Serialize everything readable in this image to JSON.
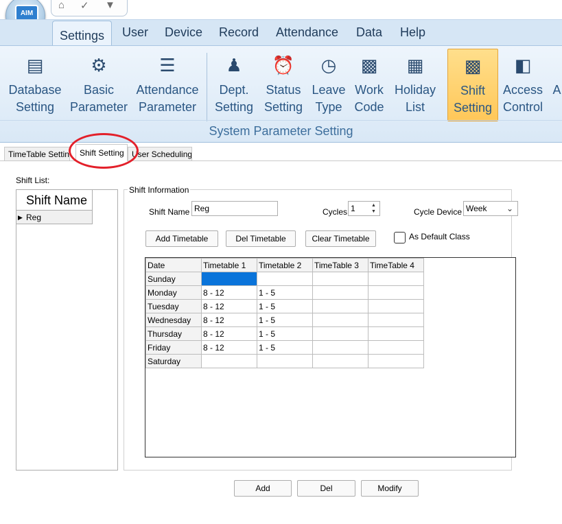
{
  "app": {
    "logo_text": "AIM"
  },
  "menu": {
    "tabs": [
      {
        "label": "Settings"
      },
      {
        "label": "User"
      },
      {
        "label": "Device"
      },
      {
        "label": "Record"
      },
      {
        "label": "Attendance"
      },
      {
        "label": "Data"
      },
      {
        "label": "Help"
      }
    ],
    "active": "Settings"
  },
  "ribbon": {
    "group_title": "System Parameter Setting",
    "buttons": [
      {
        "line1": "Database",
        "line2": "Setting",
        "icon": "database-icon"
      },
      {
        "line1": "Basic",
        "line2": "Parameter",
        "icon": "gears-icon"
      },
      {
        "line1": "Attendance",
        "line2": "Parameter",
        "icon": "scroll-icon"
      },
      {
        "line1": "Dept.",
        "line2": "Setting",
        "icon": "org-chart-icon"
      },
      {
        "line1": "Status",
        "line2": "Setting",
        "icon": "alarm-clock-icon"
      },
      {
        "line1": "Leave",
        "line2": "Type",
        "icon": "clock-person-icon"
      },
      {
        "line1": "Work",
        "line2": "Code",
        "icon": "id-gear-icon"
      },
      {
        "line1": "Holiday",
        "line2": "List",
        "icon": "calendar-icon"
      },
      {
        "line1": "Shift",
        "line2": "Setting",
        "icon": "shift-board-icon"
      },
      {
        "line1": "Access",
        "line2": "Control",
        "icon": "door-icon"
      },
      {
        "line1": "A",
        "line2": "",
        "icon": "more-icon"
      }
    ],
    "active": "Shift Setting"
  },
  "page_tabs": [
    {
      "label": "TimeTable Setting"
    },
    {
      "label": "Shift Setting"
    },
    {
      "label": "User Scheduling"
    }
  ],
  "shift_list": {
    "label": "Shift List:",
    "header": "Shift Name",
    "rows": [
      "Reg"
    ]
  },
  "shift_info": {
    "legend": "Shift Information",
    "shift_name_label": "Shift Name",
    "shift_name_value": "Reg",
    "cycles_label": "Cycles",
    "cycles_value": "1",
    "cycle_device_label": "Cycle Device",
    "cycle_device_value": "Week",
    "add_timetable": "Add Timetable",
    "del_timetable": "Del Timetable",
    "clear_timetable": "Clear Timetable",
    "default_class_label": "As Default Class",
    "default_class_checked": false
  },
  "grid": {
    "columns": [
      "Date",
      "Timetable 1",
      "Timetable 2",
      "TimeTable 3",
      "TimeTable 4"
    ],
    "rows": [
      [
        "Sunday",
        "",
        "",
        "",
        ""
      ],
      [
        "Monday",
        "8 - 12",
        "1 - 5",
        "",
        ""
      ],
      [
        "Tuesday",
        "8 - 12",
        "1 - 5",
        "",
        ""
      ],
      [
        "Wednesday",
        "8 - 12",
        "1 - 5",
        "",
        ""
      ],
      [
        "Thursday",
        "8 - 12",
        "1 - 5",
        "",
        ""
      ],
      [
        "Friday",
        "8 - 12",
        "1 - 5",
        "",
        ""
      ],
      [
        "Saturday",
        "",
        "",
        "",
        ""
      ]
    ],
    "selected_cell": "Sunday / Timetable 1"
  },
  "bottom_buttons": {
    "add": "Add",
    "del": "Del",
    "modify": "Modify"
  },
  "colors": {
    "ribbon_active": "#ffc759",
    "selection": "#0a74da",
    "annotation_circle": "#e3202a"
  }
}
